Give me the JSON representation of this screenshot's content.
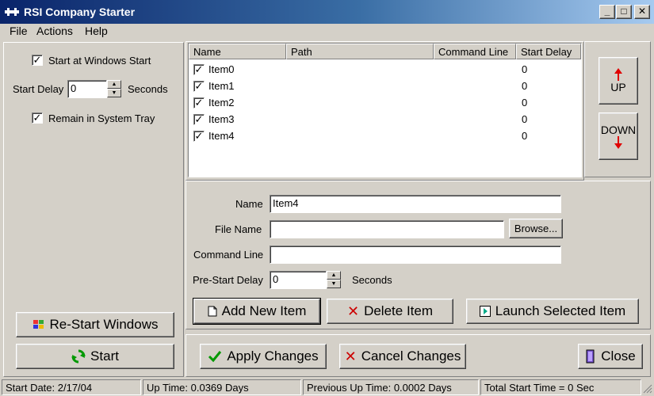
{
  "window": {
    "title": "RSI Company Starter",
    "controls": {
      "minimize": "_",
      "maximize": "□",
      "close": "✕"
    }
  },
  "menu": [
    {
      "label": "File"
    },
    {
      "label": "Actions"
    },
    {
      "label": "Help"
    }
  ],
  "settings": {
    "start_at_windows": {
      "label": "Start at Windows Start",
      "checked": true
    },
    "start_delay": {
      "label": "Start Delay",
      "value": "0",
      "unit": "Seconds"
    },
    "remain_tray": {
      "label": "Remain in System Tray",
      "checked": true
    }
  },
  "left_buttons": {
    "restart": "Re-Start Windows",
    "start": "Start"
  },
  "list": {
    "columns": [
      "Name",
      "Path",
      "Command Line",
      "Start Delay"
    ],
    "rows": [
      {
        "name": "Item0",
        "delay": "0",
        "checked": true
      },
      {
        "name": "Item1",
        "delay": "0",
        "checked": true
      },
      {
        "name": "Item2",
        "delay": "0",
        "checked": true
      },
      {
        "name": "Item3",
        "delay": "0",
        "checked": true
      },
      {
        "name": "Item4",
        "delay": "0",
        "checked": true
      }
    ]
  },
  "order_buttons": {
    "up": "UP",
    "down": "DOWN"
  },
  "editor": {
    "name_label": "Name",
    "name_value": "Item4",
    "file_label": "File Name",
    "file_value": "",
    "browse": "Browse...",
    "cmd_label": "Command Line",
    "cmd_value": "",
    "delay_label": "Pre-Start Delay",
    "delay_value": "0",
    "delay_unit": "Seconds"
  },
  "item_buttons": {
    "add": "Add New Item",
    "delete": "Delete Item",
    "launch": "Launch Selected Item"
  },
  "bottom_buttons": {
    "apply": "Apply Changes",
    "cancel": "Cancel Changes",
    "close": "Close"
  },
  "status": {
    "start_date": "Start Date: 2/17/04",
    "up_time": "Up Time: 0.0369 Days",
    "prev_up_time": "Previous Up Time: 0.0002 Days",
    "total_start": "Total Start Time = 0 Sec"
  },
  "colors": {
    "titlebar_start": "#0a246a",
    "titlebar_end": "#a6caf0",
    "face": "#d4d0c8",
    "delete_x": "#cc0000",
    "apply_check": "#009900",
    "arrow_red": "#e00000"
  }
}
